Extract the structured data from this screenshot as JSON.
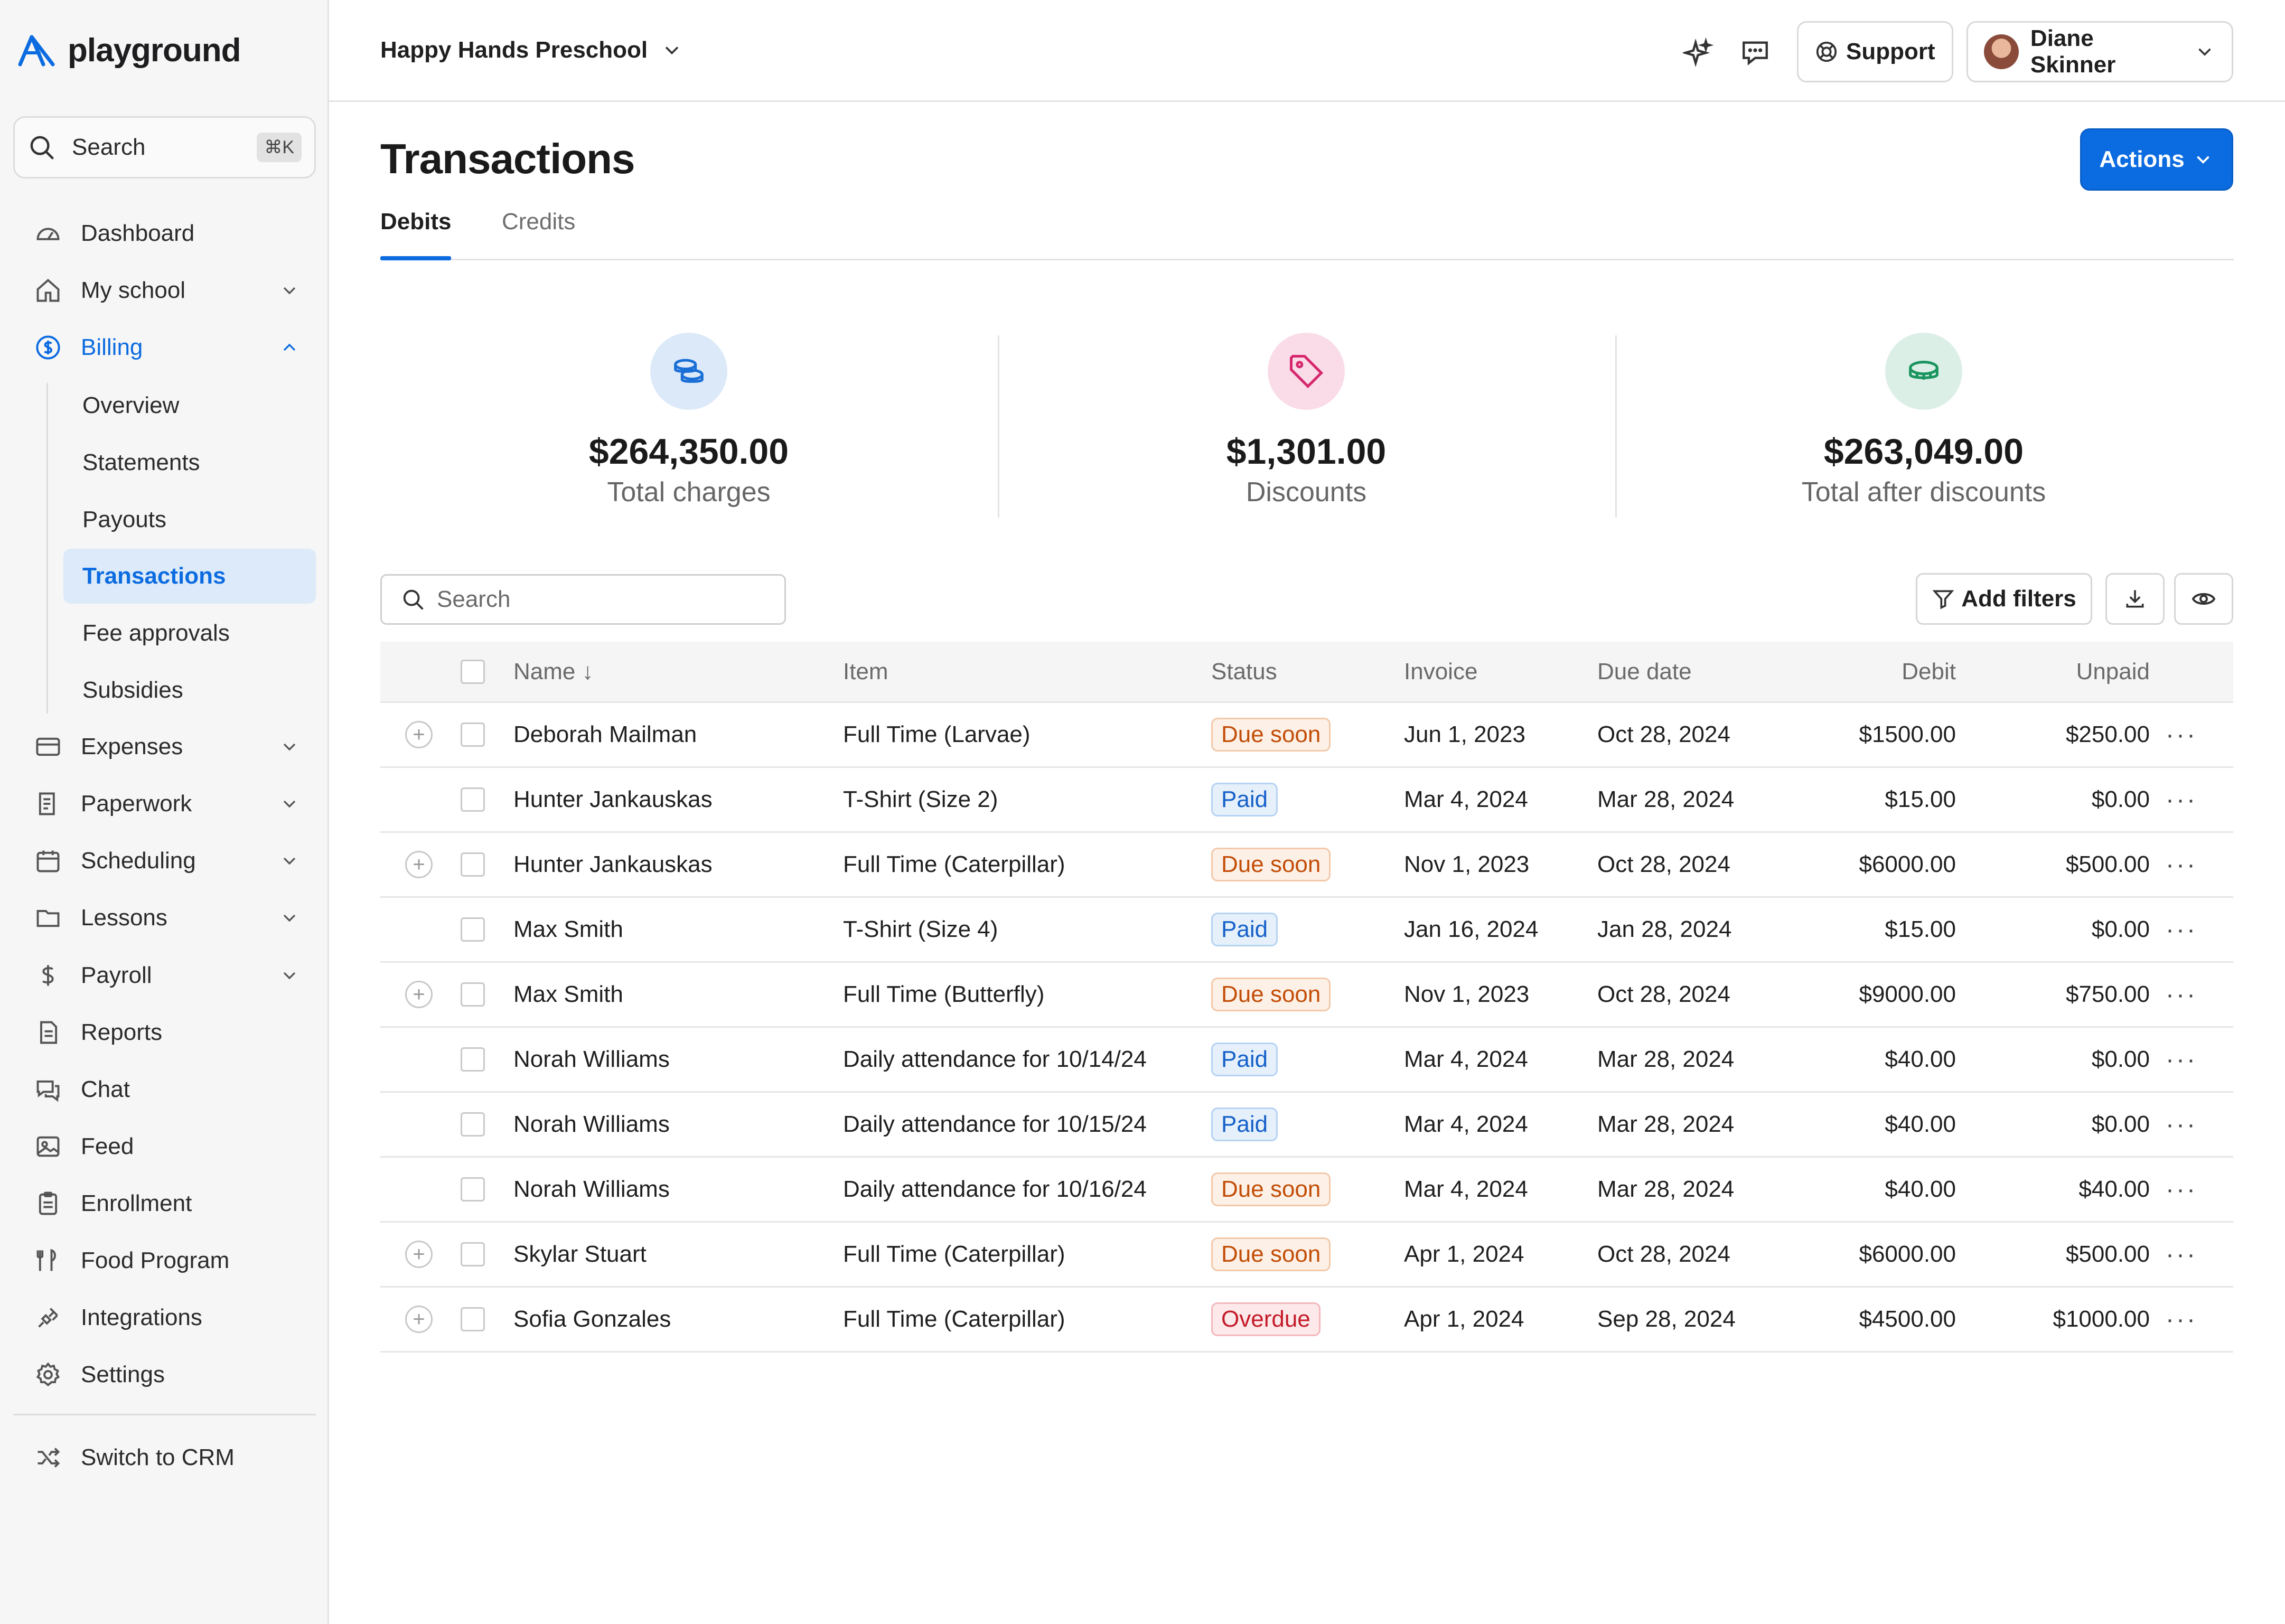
{
  "app": {
    "name": "playground"
  },
  "sidebar": {
    "search_label": "Search",
    "search_shortcut": "⌘K",
    "items": [
      {
        "label": "Dashboard",
        "icon": "dashboard-icon"
      },
      {
        "label": "My school",
        "icon": "home-icon"
      },
      {
        "label": "Billing",
        "icon": "dollar-circle-icon"
      },
      {
        "label": "Expenses",
        "icon": "card-icon"
      },
      {
        "label": "Paperwork",
        "icon": "paper-icon"
      },
      {
        "label": "Scheduling",
        "icon": "calendar-icon"
      },
      {
        "label": "Lessons",
        "icon": "folder-icon"
      },
      {
        "label": "Payroll",
        "icon": "dollar-icon"
      },
      {
        "label": "Reports",
        "icon": "report-icon"
      },
      {
        "label": "Chat",
        "icon": "chat-icon"
      },
      {
        "label": "Feed",
        "icon": "image-icon"
      },
      {
        "label": "Enrollment",
        "icon": "clipboard-icon"
      },
      {
        "label": "Food Program",
        "icon": "utensils-icon"
      },
      {
        "label": "Integrations",
        "icon": "plug-icon"
      },
      {
        "label": "Settings",
        "icon": "gear-icon"
      }
    ],
    "billing_sub": [
      "Overview",
      "Statements",
      "Payouts",
      "Transactions",
      "Fee approvals",
      "Subsidies"
    ],
    "switch_label": "Switch to CRM"
  },
  "topbar": {
    "school": "Happy Hands Preschool",
    "support": "Support",
    "user": "Diane Skinner"
  },
  "page": {
    "title": "Transactions",
    "actions": "Actions",
    "tabs": [
      "Debits",
      "Credits"
    ],
    "active_tab": "Debits"
  },
  "stats": [
    {
      "amount": "$264,350.00",
      "label": "Total charges",
      "color": "#dbe9f9",
      "icon": "coins-icon"
    },
    {
      "amount": "$1,301.00",
      "label": "Discounts",
      "color": "#f9dce8",
      "icon": "tag-icon"
    },
    {
      "amount": "$263,049.00",
      "label": "Total after discounts",
      "color": "#dcefe6",
      "icon": "coin-icon"
    }
  ],
  "toolbar": {
    "search_placeholder": "Search",
    "add_filters": "Add filters"
  },
  "table": {
    "headers": {
      "name": "Name ↓",
      "item": "Item",
      "status": "Status",
      "invoice": "Invoice",
      "due": "Due date",
      "debit": "Debit",
      "unpaid": "Unpaid"
    },
    "rows": [
      {
        "expand": true,
        "name": "Deborah Mailman",
        "item": "Full Time (Larvae)",
        "status": "Due soon",
        "invoice": "Jun 1, 2023",
        "due": "Oct 28, 2024",
        "debit": "$1500.00",
        "unpaid": "$250.00"
      },
      {
        "expand": false,
        "name": "Hunter Jankauskas",
        "item": "T-Shirt (Size 2)",
        "status": "Paid",
        "invoice": "Mar 4, 2024",
        "due": "Mar 28, 2024",
        "debit": "$15.00",
        "unpaid": "$0.00"
      },
      {
        "expand": true,
        "name": "Hunter Jankauskas",
        "item": "Full Time (Caterpillar)",
        "status": "Due soon",
        "invoice": "Nov 1, 2023",
        "due": "Oct 28, 2024",
        "debit": "$6000.00",
        "unpaid": "$500.00"
      },
      {
        "expand": false,
        "name": "Max Smith",
        "item": "T-Shirt (Size 4)",
        "status": "Paid",
        "invoice": "Jan 16, 2024",
        "due": "Jan 28, 2024",
        "debit": "$15.00",
        "unpaid": "$0.00"
      },
      {
        "expand": true,
        "name": "Max Smith",
        "item": "Full Time (Butterfly)",
        "status": "Due soon",
        "invoice": "Nov 1, 2023",
        "due": "Oct 28, 2024",
        "debit": "$9000.00",
        "unpaid": "$750.00"
      },
      {
        "expand": false,
        "name": "Norah Williams",
        "item": "Daily attendance for 10/14/24",
        "status": "Paid",
        "invoice": "Mar 4, 2024",
        "due": "Mar 28, 2024",
        "debit": "$40.00",
        "unpaid": "$0.00"
      },
      {
        "expand": false,
        "name": "Norah Williams",
        "item": "Daily attendance for 10/15/24",
        "status": "Paid",
        "invoice": "Mar 4, 2024",
        "due": "Mar 28, 2024",
        "debit": "$40.00",
        "unpaid": "$0.00"
      },
      {
        "expand": false,
        "name": "Norah Williams",
        "item": "Daily attendance for 10/16/24",
        "status": "Due soon",
        "invoice": "Mar 4, 2024",
        "due": "Mar 28, 2024",
        "debit": "$40.00",
        "unpaid": "$40.00"
      },
      {
        "expand": true,
        "name": "Skylar Stuart",
        "item": "Full Time (Caterpillar)",
        "status": "Due soon",
        "invoice": "Apr 1, 2024",
        "due": "Oct 28, 2024",
        "debit": "$6000.00",
        "unpaid": "$500.00"
      },
      {
        "expand": true,
        "name": "Sofia Gonzales",
        "item": "Full Time (Caterpillar)",
        "status": "Overdue",
        "invoice": "Apr 1, 2024",
        "due": "Sep 28, 2024",
        "debit": "$4500.00",
        "unpaid": "$1000.00"
      }
    ]
  },
  "colors": {
    "accent": "#0b6be0",
    "paid": "#1560c8",
    "due_soon": "#c24d07",
    "overdue": "#c41a28"
  }
}
